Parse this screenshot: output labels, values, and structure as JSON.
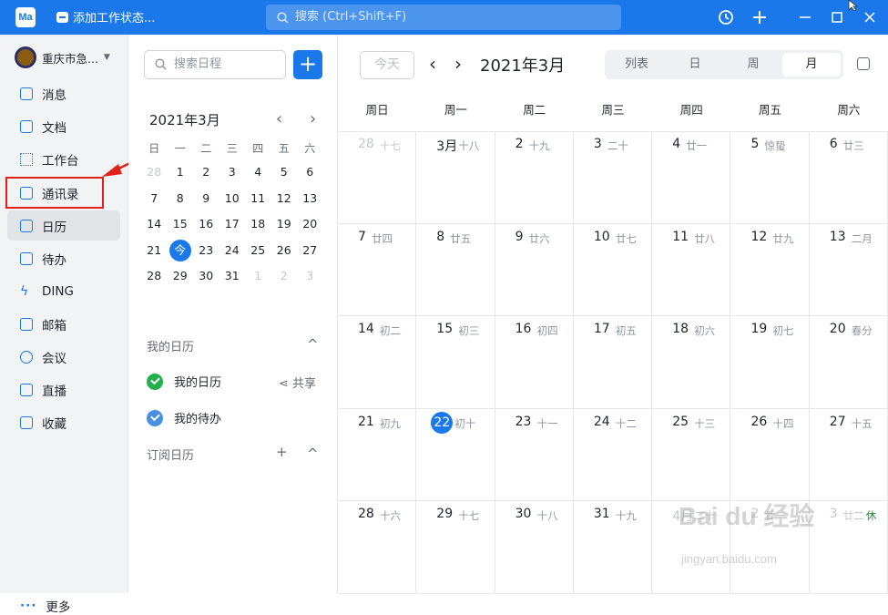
{
  "titlebar": {
    "logo": "Ma",
    "status": "添加工作状态...",
    "search_placeholder": "搜索 (Ctrl+Shift+F)",
    "icons": [
      "history-icon",
      "plus-icon",
      "minimize-icon",
      "maximize-icon",
      "close-icon"
    ],
    "accent": "#1a78eb"
  },
  "sidebar": {
    "org_name": "重庆市急...",
    "items": [
      {
        "label": "消息",
        "icon": "message-icon"
      },
      {
        "label": "文档",
        "icon": "document-icon"
      },
      {
        "label": "工作台",
        "icon": "workbench-icon"
      },
      {
        "label": "通讯录",
        "icon": "contacts-icon"
      },
      {
        "label": "日历",
        "icon": "calendar-icon"
      },
      {
        "label": "待办",
        "icon": "todo-icon"
      },
      {
        "label": "DING",
        "icon": "ding-icon"
      },
      {
        "label": "邮箱",
        "icon": "mail-icon"
      },
      {
        "label": "会议",
        "icon": "meeting-icon"
      },
      {
        "label": "直播",
        "icon": "live-icon"
      },
      {
        "label": "收藏",
        "icon": "favorites-icon"
      }
    ],
    "active": "日历",
    "highlighted": "通讯录",
    "more_dots": "···",
    "more_label": "更多"
  },
  "minical": {
    "search_placeholder": "搜索日程",
    "add": "+",
    "title": "2021年3月",
    "prev": "‹",
    "next": "›",
    "weekdays": [
      "日",
      "一",
      "二",
      "三",
      "四",
      "五",
      "六"
    ],
    "weeks": [
      [
        {
          "d": "28",
          "g": true
        },
        {
          "d": "1"
        },
        {
          "d": "2"
        },
        {
          "d": "3"
        },
        {
          "d": "4"
        },
        {
          "d": "5"
        },
        {
          "d": "6"
        }
      ],
      [
        {
          "d": "7"
        },
        {
          "d": "8"
        },
        {
          "d": "9"
        },
        {
          "d": "10"
        },
        {
          "d": "11"
        },
        {
          "d": "12"
        },
        {
          "d": "13"
        }
      ],
      [
        {
          "d": "14"
        },
        {
          "d": "15"
        },
        {
          "d": "16"
        },
        {
          "d": "17"
        },
        {
          "d": "18"
        },
        {
          "d": "19"
        },
        {
          "d": "20"
        }
      ],
      [
        {
          "d": "21"
        },
        {
          "d": "今",
          "today": true
        },
        {
          "d": "23"
        },
        {
          "d": "24"
        },
        {
          "d": "25"
        },
        {
          "d": "26"
        },
        {
          "d": "27"
        }
      ],
      [
        {
          "d": "28"
        },
        {
          "d": "29"
        },
        {
          "d": "30"
        },
        {
          "d": "31"
        },
        {
          "d": "1",
          "g": true
        },
        {
          "d": "2",
          "g": true
        },
        {
          "d": "3",
          "g": true
        }
      ]
    ],
    "my_calendars_title": "我的日历",
    "my_calendars": [
      {
        "label": "我的日历",
        "color": "#21b04b"
      },
      {
        "label": "我的待办",
        "color": "#4a90e2"
      }
    ],
    "share_label": "共享",
    "subscribed_title": "订阅日历",
    "collapse": "^",
    "add_sub": "+"
  },
  "main": {
    "today_label": "今天",
    "prev": "‹",
    "next": "›",
    "title": "2021年3月",
    "views": [
      "列表",
      "日",
      "周",
      "月"
    ],
    "active_view": "月",
    "weekdays": [
      "周日",
      "周一",
      "周二",
      "周三",
      "周四",
      "周五",
      "周六"
    ],
    "weeks": [
      [
        {
          "d": "28",
          "l": "十七",
          "dim": true
        },
        {
          "d": "3月",
          "l": "十八"
        },
        {
          "d": "2",
          "l": "十九"
        },
        {
          "d": "3",
          "l": "二十"
        },
        {
          "d": "4",
          "l": "廿一"
        },
        {
          "d": "5",
          "l": "惊蛰"
        },
        {
          "d": "6",
          "l": "廿三"
        }
      ],
      [
        {
          "d": "7",
          "l": "廿四"
        },
        {
          "d": "8",
          "l": "廿五"
        },
        {
          "d": "9",
          "l": "廿六"
        },
        {
          "d": "10",
          "l": "廿七"
        },
        {
          "d": "11",
          "l": "廿八"
        },
        {
          "d": "12",
          "l": "廿九"
        },
        {
          "d": "13",
          "l": "二月"
        }
      ],
      [
        {
          "d": "14",
          "l": "初二"
        },
        {
          "d": "15",
          "l": "初三"
        },
        {
          "d": "16",
          "l": "初四"
        },
        {
          "d": "17",
          "l": "初五"
        },
        {
          "d": "18",
          "l": "初六"
        },
        {
          "d": "19",
          "l": "初七"
        },
        {
          "d": "20",
          "l": "春分"
        }
      ],
      [
        {
          "d": "21",
          "l": "初九"
        },
        {
          "d": "22",
          "l": "初十",
          "today": true
        },
        {
          "d": "23",
          "l": "十一"
        },
        {
          "d": "24",
          "l": "十二"
        },
        {
          "d": "25",
          "l": "十三"
        },
        {
          "d": "26",
          "l": "十四"
        },
        {
          "d": "27",
          "l": "十五"
        }
      ],
      [
        {
          "d": "28",
          "l": "十六"
        },
        {
          "d": "29",
          "l": "十七"
        },
        {
          "d": "30",
          "l": "十八"
        },
        {
          "d": "31",
          "l": "十九"
        },
        {
          "d": "4月",
          "l": "二十",
          "dim": true
        },
        {
          "d": "2",
          "l": "廿一",
          "dim": true
        },
        {
          "d": "3",
          "l": "廿二",
          "dim": true,
          "badge": "休"
        }
      ]
    ]
  },
  "watermark": {
    "main": "Bai du 经验",
    "sub": "jingyan.baidu.com"
  }
}
